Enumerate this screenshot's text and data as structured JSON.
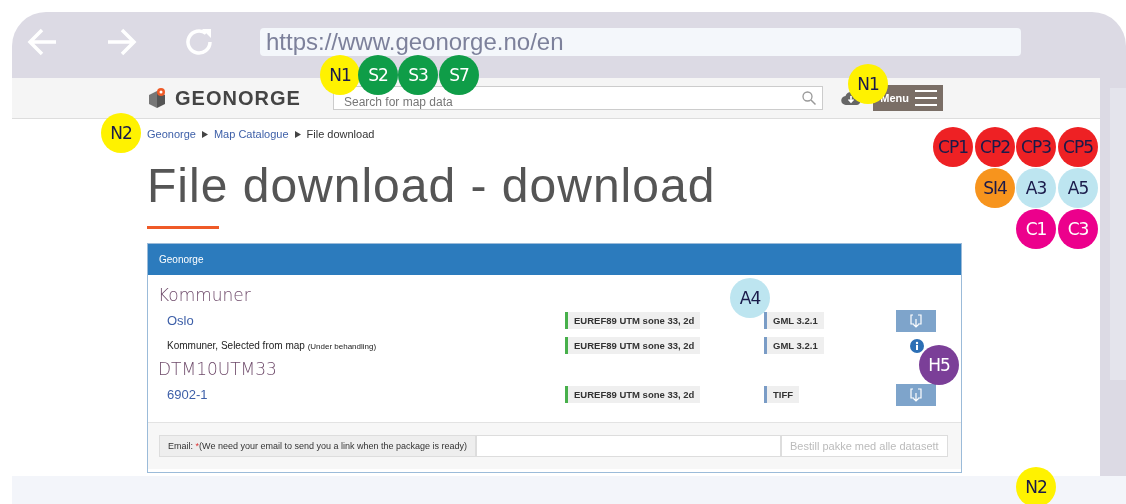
{
  "browser": {
    "url": "https://www.geonorge.no/en"
  },
  "header": {
    "logo": "GEONORGE",
    "search_placeholder": "Search for map data",
    "menu": "Menu"
  },
  "breadcrumb": [
    "Geonorge",
    "Map Catalogue",
    "File download"
  ],
  "title": "File download - download",
  "panel": {
    "title": "Geonorge",
    "groups": [
      {
        "title": "Kommuner",
        "items": [
          {
            "kind": "dataset",
            "name": "Oslo",
            "projection": "EUREF89 UTM sone 33, 2d",
            "format": "GML 3.2.1"
          },
          {
            "kind": "selection",
            "name": "Kommuner, Selected from map",
            "note": "(Under behandling)",
            "projection": "EUREF89 UTM sone 33, 2d",
            "format": "GML 3.2.1"
          }
        ]
      },
      {
        "title": "DTM10UTM33",
        "items": [
          {
            "kind": "dataset",
            "name": "6902-1",
            "projection": "EUREF89 UTM sone 33, 2d",
            "format": "TIFF"
          }
        ]
      }
    ],
    "email_label": "Email:",
    "required_mark": "*",
    "email_hint": "(We need your email to send you a link when the package is ready)",
    "order_button": "Bestill pakke med alle datasett"
  },
  "badges": [
    {
      "label": "N1",
      "color": "#fff200"
    },
    {
      "label": "S2",
      "color": "#0f9d48"
    },
    {
      "label": "S3",
      "color": "#0f9d48"
    },
    {
      "label": "S7",
      "color": "#0f9d48"
    },
    {
      "label": "N1",
      "color": "#fff200"
    },
    {
      "label": "N2",
      "color": "#fff200"
    },
    {
      "label": "CP1",
      "color": "#ee2124"
    },
    {
      "label": "CP2",
      "color": "#ee2124"
    },
    {
      "label": "CP3",
      "color": "#ee2124"
    },
    {
      "label": "CP5",
      "color": "#ee2124"
    },
    {
      "label": "SI4",
      "color": "#f7941d"
    },
    {
      "label": "A3",
      "color": "#bde5f0"
    },
    {
      "label": "A5",
      "color": "#bde5f0"
    },
    {
      "label": "C1",
      "color": "#ec008c"
    },
    {
      "label": "C3",
      "color": "#ec008c"
    },
    {
      "label": "A4",
      "color": "#bde5f0"
    },
    {
      "label": "H5",
      "color": "#7b3f98"
    },
    {
      "label": "N2",
      "color": "#fff200"
    }
  ]
}
